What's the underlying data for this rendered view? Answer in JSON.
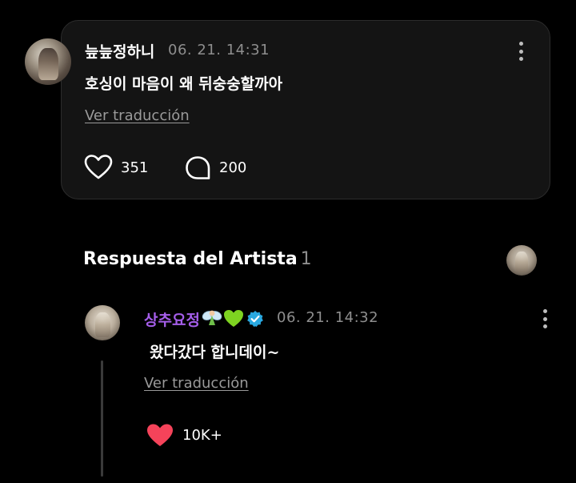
{
  "post": {
    "username": "늪늪정하니",
    "timestamp": "06. 21. 14:31",
    "text": "호싱이 마음이 왜 뒤숭숭할까아",
    "translate_label": "Ver traducción",
    "likes": "351",
    "comments": "200"
  },
  "artist_section": {
    "title": "Respuesta del Artista",
    "count": "1"
  },
  "reply": {
    "username": "상추요정",
    "timestamp": "06. 21. 14:32",
    "text": "왔다갔다 합니데이~",
    "translate_label": "Ver traducción",
    "likes": "10K+"
  },
  "colors": {
    "background": "#000000",
    "card": "#141414",
    "artist_name": "#a55eea",
    "liked_heart": "#f5435a",
    "verified_badge": "#29a8e0",
    "green_heart": "#7ed321"
  },
  "icons": [
    "heart-outline-icon",
    "comment-bubble-icon",
    "kebab-menu-icon",
    "fairy-emoji-icon",
    "green-heart-emoji-icon",
    "verified-badge-icon",
    "heart-filled-icon"
  ]
}
